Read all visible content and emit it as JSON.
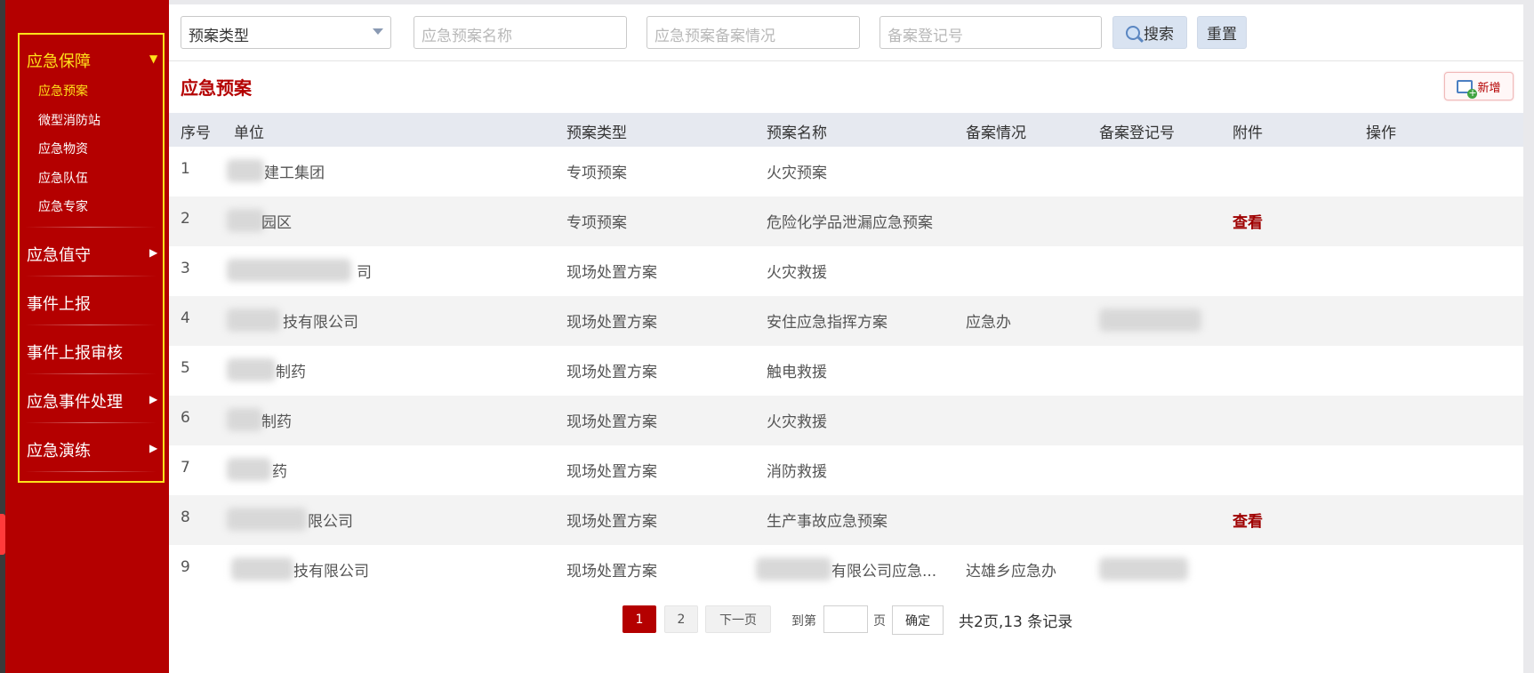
{
  "sidebar": {
    "groups": [
      {
        "label": "应急保障",
        "active": true,
        "items": [
          "应急预案",
          "微型消防站",
          "应急物资",
          "应急队伍",
          "应急专家"
        ]
      },
      {
        "label": "应急值守"
      },
      {
        "label": "事件上报"
      },
      {
        "label": "事件上报审核"
      },
      {
        "label": "应急事件处理"
      },
      {
        "label": "应急演练"
      }
    ]
  },
  "filters": {
    "type_select": "预案类型",
    "name_placeholder": "应急预案名称",
    "record_placeholder": "应急预案备案情况",
    "regno_placeholder": "备案登记号",
    "search_label": "搜索",
    "reset_label": "重置"
  },
  "section": {
    "title": "应急预案",
    "add_label": "新增"
  },
  "table": {
    "headers": [
      "序号",
      "单位",
      "预案类型",
      "预案名称",
      "备案情况",
      "备案登记号",
      "附件",
      "操作"
    ],
    "rows": [
      {
        "no": "1",
        "unit": "建工集团",
        "type": "专项预案",
        "name": "火灾预案",
        "record": "",
        "regno": "",
        "attach": ""
      },
      {
        "no": "2",
        "unit": "园区",
        "type": "专项预案",
        "name": "危险化学品泄漏应急预案",
        "record": "",
        "regno": "",
        "attach": "查看"
      },
      {
        "no": "3",
        "unit": "司",
        "type": "现场处置方案",
        "name": "火灾救援",
        "record": "",
        "regno": "",
        "attach": ""
      },
      {
        "no": "4",
        "unit": "技有限公司",
        "type": "现场处置方案",
        "name": "安住应急指挥方案",
        "record": "应急办",
        "regno": "",
        "attach": ""
      },
      {
        "no": "5",
        "unit": "制药",
        "type": "现场处置方案",
        "name": "触电救援",
        "record": "",
        "regno": "",
        "attach": ""
      },
      {
        "no": "6",
        "unit": "制药",
        "type": "现场处置方案",
        "name": "火灾救援",
        "record": "",
        "regno": "",
        "attach": ""
      },
      {
        "no": "7",
        "unit": "药",
        "type": "现场处置方案",
        "name": "消防救援",
        "record": "",
        "regno": "",
        "attach": ""
      },
      {
        "no": "8",
        "unit": "限公司",
        "type": "现场处置方案",
        "name": "生产事故应急预案",
        "record": "",
        "regno": "",
        "attach": "查看"
      },
      {
        "no": "9",
        "unit": "技有限公司",
        "type": "现场处置方案",
        "name": "有限公司应急...",
        "record": "达雄乡应急办",
        "regno": "",
        "attach": ""
      }
    ]
  },
  "pagination": {
    "page1": "1",
    "page2": "2",
    "next": "下一页",
    "goto": "到第",
    "page_unit": "页",
    "confirm": "确定",
    "total": "共2页,13 条记录"
  },
  "colors": {
    "brand": "#b40000",
    "highlight": "#ffe21a"
  }
}
